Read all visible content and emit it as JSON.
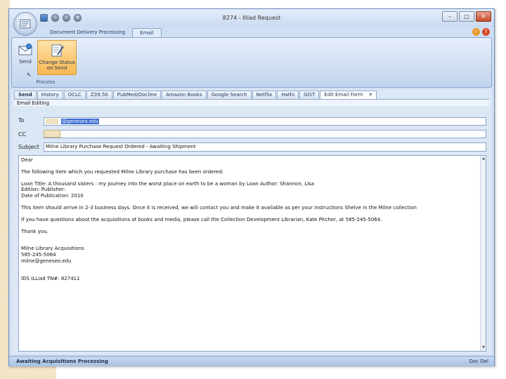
{
  "window": {
    "title": "8274 - Illiad Request",
    "controls": {
      "minimize": "–",
      "maximize": "□",
      "close": "✕"
    }
  },
  "ribbon": {
    "tabs": [
      {
        "label": "Document Delivery Processing",
        "active": false
      },
      {
        "label": "Email",
        "active": true
      }
    ],
    "group": {
      "label": "Process",
      "buttons": [
        {
          "label": "Send",
          "icon": "envelope-icon"
        },
        {
          "label": "Change Status on Send",
          "icon": "edit-document-icon"
        }
      ]
    }
  },
  "doc_tabs": [
    {
      "label": "Send",
      "bold": true
    },
    {
      "label": "History"
    },
    {
      "label": "OCLC"
    },
    {
      "label": "Z39.50"
    },
    {
      "label": "PubMed/Docline"
    },
    {
      "label": "Amazon Books"
    },
    {
      "label": "Google Search"
    },
    {
      "label": "Netflix"
    },
    {
      "label": "Hathi"
    },
    {
      "label": "GIST"
    },
    {
      "label": "Edit Email Form",
      "active": true,
      "close": "✕"
    }
  ],
  "email_editing": {
    "header": "Email Editing",
    "to_label": "To",
    "to_value": "@geneseo.edu",
    "cc_label": "CC",
    "cc_value": "",
    "subject_label": "Subject",
    "subject_value": "Milne Library Purchase Request Ordered - Awaiting Shipment"
  },
  "email_body": {
    "greeting": "Dear",
    "intro": "The following item which you requested Milne Library purchase has been ordered:",
    "loan_title": "Loan Title: A thousand sisters : my journey into the worst place on earth to be a woman  by Loan Author: Shannon, Lisa",
    "edition": "Edition:    Publisher:",
    "date": "Date of Publication: 2010",
    "arrival": "This item should arrive in 2-3 business days. Once it is received, we will contact you and make it available as per your instructions Shelve in the Milne collection",
    "questions": "If you have questions about the acquisitions of books and media, please call the Collection Development Librarian, Kate Pitcher, at 585-245-5064.",
    "thanks": "Thank you.",
    "sig_name": "Milne Library Acquisitions",
    "sig_phone": "585-245-5064",
    "sig_email": "milne@geneseo.edu",
    "tn": "IDS ILLiad TN#: 827411"
  },
  "status": {
    "left": "Awaiting Acquisitions Processing",
    "right": "Doc Del"
  },
  "colors": {
    "ribbon_active": "#f7b751",
    "selection": "#3a6bd4",
    "frame": "#cfdff3"
  }
}
